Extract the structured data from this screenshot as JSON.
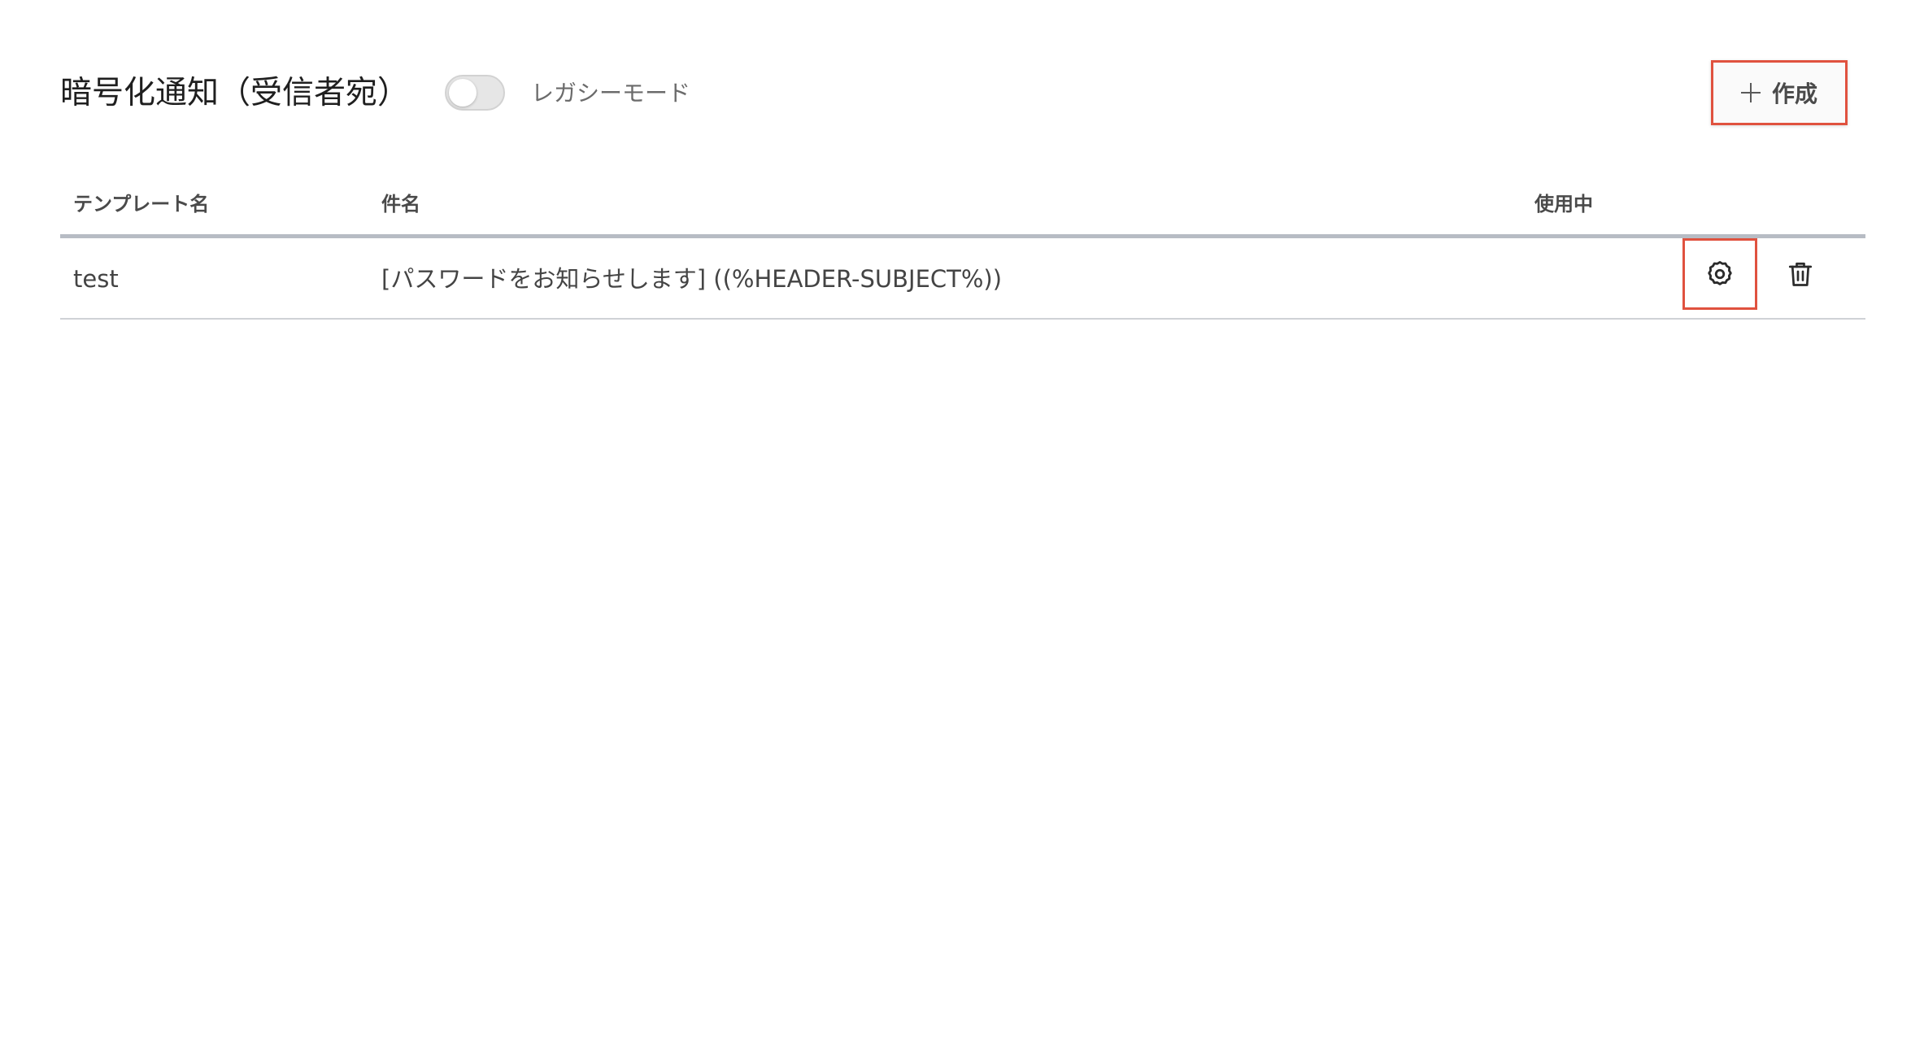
{
  "header": {
    "title": "暗号化通知（受信者宛）",
    "legacy_toggle_label": "レガシーモード",
    "legacy_toggle_on": false,
    "create_button_label": "作成"
  },
  "table": {
    "columns": [
      "テンプレート名",
      "件名",
      "使用中"
    ],
    "rows": [
      {
        "template_name": "test",
        "subject": "[パスワードをお知らせします] ((%HEADER-SUBJECT%))",
        "in_use": ""
      }
    ]
  },
  "colors": {
    "highlight": "#e0523f",
    "header_border": "#b7bcc4"
  }
}
